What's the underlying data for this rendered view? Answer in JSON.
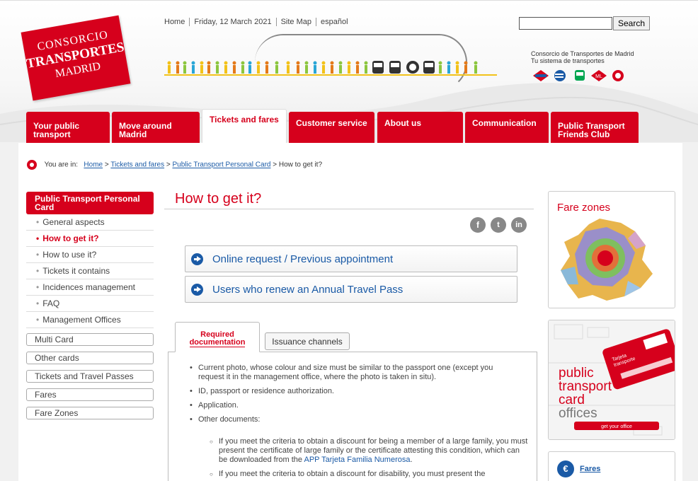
{
  "header": {
    "logo": {
      "line1": "CONSORCIO",
      "line2": "TRANSPORTES",
      "line3": "MADRID"
    },
    "toplinks": [
      "Home",
      "Friday, 12 March 2021",
      "Site Map",
      "español"
    ],
    "search": {
      "value": "",
      "button": "Search"
    },
    "consorcio": {
      "line1": "Consorcio de Transportes de Madrid",
      "line2": "Tu sistema de transportes"
    },
    "mode_icons": [
      "metro-icon",
      "cercanias-icon",
      "bus-icon",
      "metro-ligero-icon",
      "emt-icon"
    ],
    "accent_color": "#d6001c"
  },
  "nav": {
    "tabs": [
      {
        "label1": "Your public",
        "label2": "transport"
      },
      {
        "label1": "Move around",
        "label2": "Madrid"
      },
      {
        "label1": "Tickets and fares",
        "label2": ""
      },
      {
        "label1": "Customer service",
        "label2": ""
      },
      {
        "label1": "About us",
        "label2": ""
      },
      {
        "label1": "Communication",
        "label2": ""
      },
      {
        "label1": "Public Transport",
        "label2": "Friends Club"
      }
    ],
    "active": "Tickets and fares"
  },
  "breadcrumb": {
    "prefix": "You are in:",
    "items": [
      "Home",
      "Tickets and fares",
      "Public Transport Personal Card",
      "How to get it?"
    ]
  },
  "sidebar": {
    "header": "Public Transport Personal Card",
    "sub_items": [
      "General aspects",
      "How to get it?",
      "How to use it?",
      "Tickets it contains",
      "Incidences management",
      "FAQ",
      "Management Offices"
    ],
    "current": "How to get it?",
    "sections": [
      "Multi Card",
      "Other cards",
      "Tickets and Travel Passes",
      "Fares",
      "Fare Zones"
    ]
  },
  "main": {
    "title": "How to get it?",
    "social": [
      "f",
      "t",
      "in"
    ],
    "links": [
      "Online request / Previous appointment",
      "Users who renew an Annual Travel Pass"
    ],
    "tabs": {
      "required_line1": "Required",
      "required_line2": "documentation",
      "issuance": "Issuance channels"
    },
    "documents": [
      "Current photo, whose colour and size must be similar to the passport one (except you request it in the management office, where the photo is taken in situ).",
      "ID, passport or residence authorization.",
      "Application.",
      "Other documents:"
    ],
    "sub_documents": {
      "item1_text": "If you meet the criteria to obtain a discount for being a member of a large family, you must present the certificate of large family or  the certificate attesting this condition, which can be downloaded from the ",
      "item1_link": "APP Tarjeta Familia Numerosa",
      "item1_end": ".",
      "item2_text": "If you meet the criteria to obtain a discount for disability, you must present the"
    }
  },
  "right": {
    "fare_zones_title": "Fare zones",
    "card_offices": {
      "line1": "public",
      "line2": "transport",
      "line3": "card",
      "line4": "offices",
      "button": "get your office"
    },
    "fares_icon": "€",
    "fares_link": "Fares"
  }
}
